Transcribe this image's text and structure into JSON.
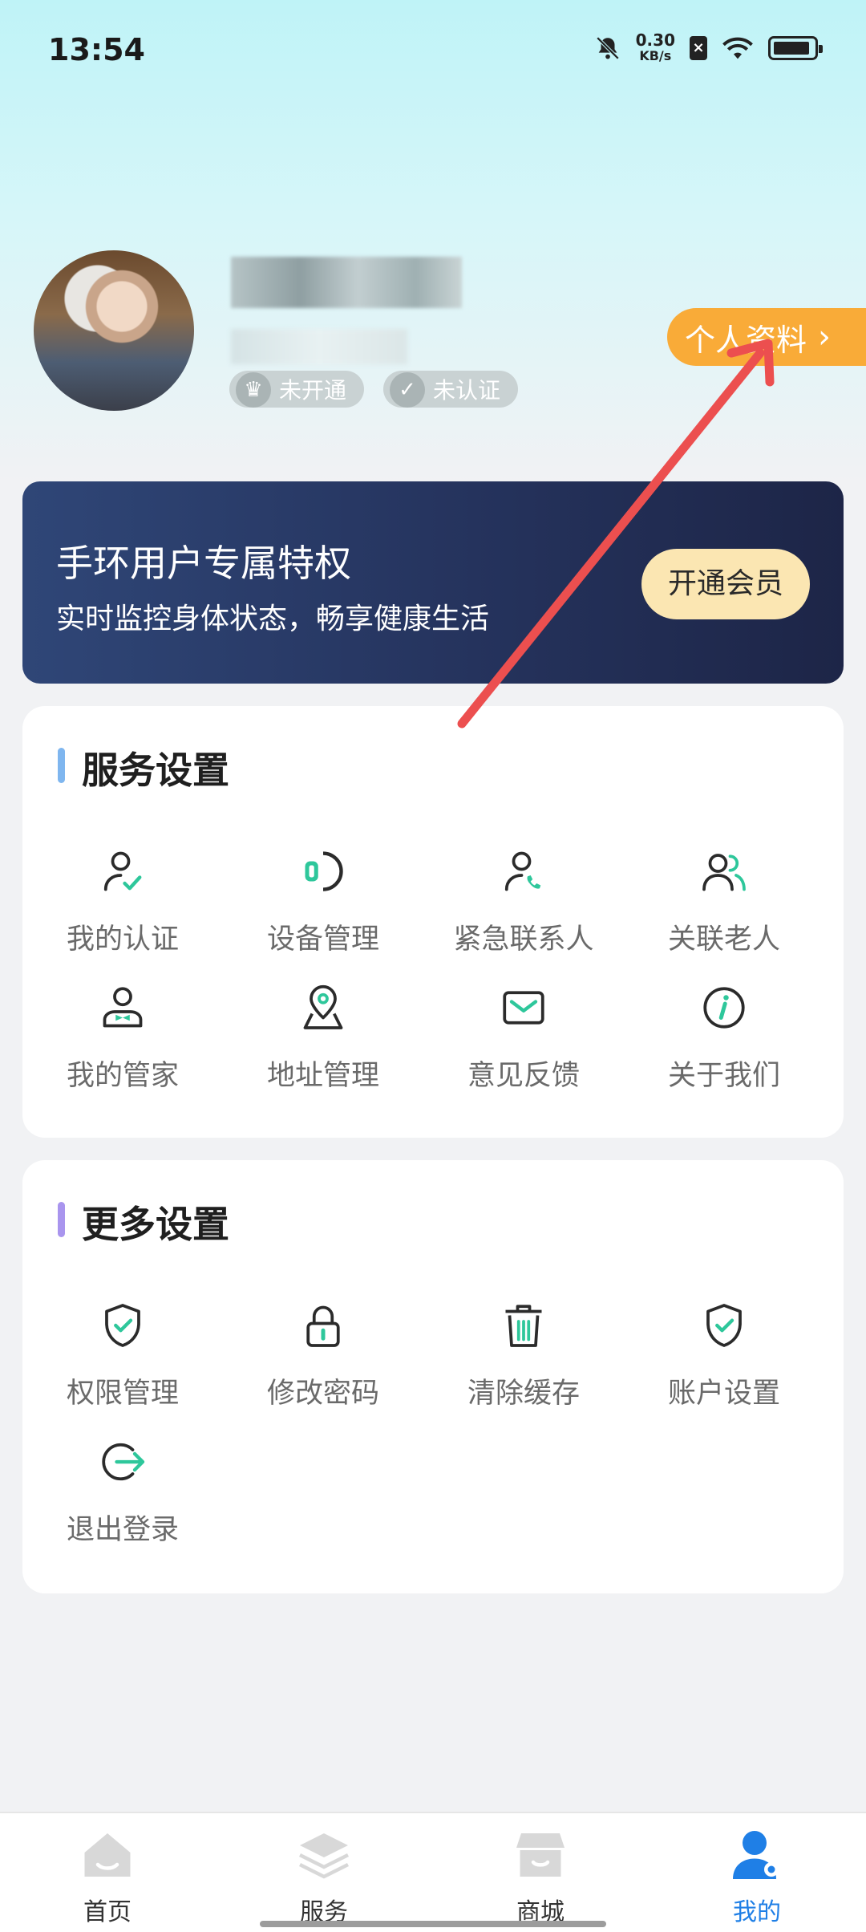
{
  "status_bar": {
    "time": "13:54",
    "net_speed_value": "0.30",
    "net_speed_unit": "KB/s"
  },
  "profile": {
    "badges": {
      "vip": "未开通",
      "cert": "未认证"
    },
    "profile_button": "个人资料"
  },
  "banner": {
    "title": "手环用户专属特权",
    "subtitle": "实时监控身体状态，畅享健康生活",
    "button": "开通会员"
  },
  "service_settings": {
    "title": "服务设置",
    "accent": "#7fb6ef",
    "items": [
      {
        "label": "我的认证",
        "icon": "user-check-icon"
      },
      {
        "label": "设备管理",
        "icon": "smartwatch-icon"
      },
      {
        "label": "紧急联系人",
        "icon": "user-phone-icon"
      },
      {
        "label": "关联老人",
        "icon": "users-icon"
      },
      {
        "label": "我的管家",
        "icon": "butler-icon"
      },
      {
        "label": "地址管理",
        "icon": "location-pin-icon"
      },
      {
        "label": "意见反馈",
        "icon": "mail-icon"
      },
      {
        "label": "关于我们",
        "icon": "info-icon"
      }
    ]
  },
  "more_settings": {
    "title": "更多设置",
    "accent": "#a995ee",
    "items": [
      {
        "label": "权限管理",
        "icon": "shield-check-icon"
      },
      {
        "label": "修改密码",
        "icon": "lock-icon"
      },
      {
        "label": "清除缓存",
        "icon": "trash-icon"
      },
      {
        "label": "账户设置",
        "icon": "shield-check-icon"
      },
      {
        "label": "退出登录",
        "icon": "logout-icon"
      }
    ]
  },
  "bottom_nav": {
    "items": [
      {
        "label": "首页",
        "icon": "home-icon",
        "active": false
      },
      {
        "label": "服务",
        "icon": "layers-icon",
        "active": false
      },
      {
        "label": "商城",
        "icon": "store-icon",
        "active": false
      },
      {
        "label": "我的",
        "icon": "user-profile-icon",
        "active": true
      }
    ]
  },
  "colors": {
    "icon_dark": "#2b2b2b",
    "icon_accent": "#2ec79b",
    "active_nav": "#1f7fe6",
    "profile_button": "#f9ab38",
    "annotation_arrow": "#ec4f4f"
  }
}
